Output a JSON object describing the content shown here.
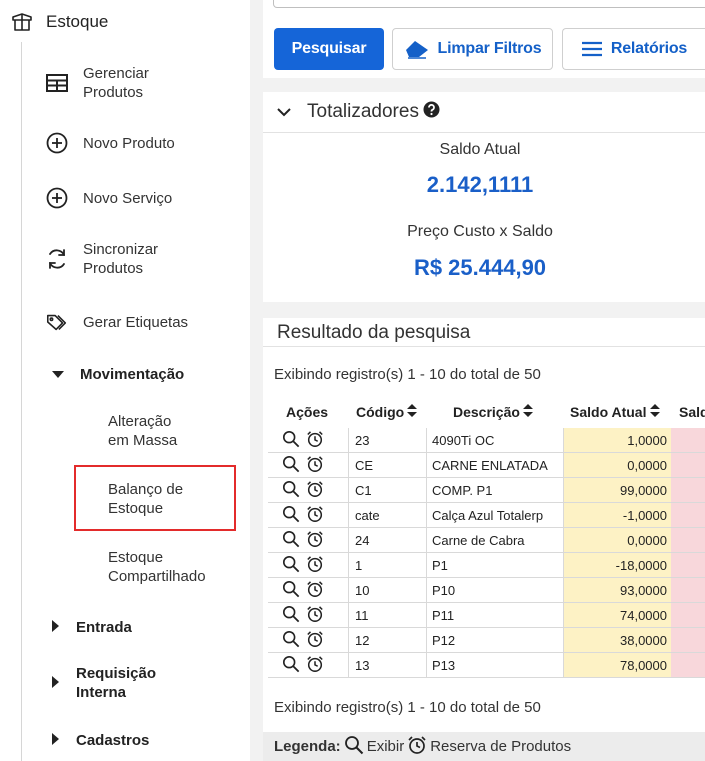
{
  "sidebar": {
    "module": "Estoque",
    "items": [
      {
        "label": "Gerenciar\nProdutos",
        "icon": "product-list-icon"
      },
      {
        "label": "Novo Produto",
        "icon": "plus-circle-icon"
      },
      {
        "label": "Novo Serviço",
        "icon": "plus-circle-icon"
      },
      {
        "label": "Sincronizar\nProdutos",
        "icon": "sync-icon"
      },
      {
        "label": "Gerar Etiquetas",
        "icon": "tag-icon"
      }
    ],
    "movimentacao": {
      "label": "Movimentação",
      "subitems": [
        "Alteração\nem Massa",
        "Balanço de\nEstoque",
        "Estoque\nCompartilhado"
      ]
    },
    "groups": [
      "Entrada",
      "Requisição\nInterna",
      "Cadastros"
    ]
  },
  "toolbar": {
    "search_label": "Pesquisar",
    "clear_label": "Limpar Filtros",
    "reports_label": "Relatórios"
  },
  "totals": {
    "title": "Totalizadores",
    "saldo_label": "Saldo Atual",
    "saldo_value": "2.142,1111",
    "custo_label": "Preço Custo x Saldo",
    "custo_value": "R$ 25.444,90"
  },
  "results": {
    "title": "Resultado da pesquisa",
    "info_top": "Exibindo registro(s) 1 - 10 do total de 50",
    "info_bottom": "Exibindo registro(s) 1 - 10 do total de 50",
    "columns": {
      "acoes": "Ações",
      "codigo": "Código",
      "descricao": "Descrição",
      "saldo": "Saldo Atual",
      "next": "Sald"
    },
    "rows": [
      {
        "codigo": "23",
        "descricao": "4090Ti OC",
        "saldo": "1,0000"
      },
      {
        "codigo": "CE",
        "descricao": "CARNE ENLATADA",
        "saldo": "0,0000"
      },
      {
        "codigo": "C1",
        "descricao": "COMP. P1",
        "saldo": "99,0000"
      },
      {
        "codigo": "cate",
        "descricao": "Calça Azul Totalerp",
        "saldo": "-1,0000"
      },
      {
        "codigo": "24",
        "descricao": "Carne de Cabra",
        "saldo": "0,0000"
      },
      {
        "codigo": "1",
        "descricao": "P1",
        "saldo": "-18,0000"
      },
      {
        "codigo": "10",
        "descricao": "P10",
        "saldo": "93,0000"
      },
      {
        "codigo": "11",
        "descricao": "P11",
        "saldo": "74,0000"
      },
      {
        "codigo": "12",
        "descricao": "P12",
        "saldo": "38,0000"
      },
      {
        "codigo": "13",
        "descricao": "P13",
        "saldo": "78,0000"
      }
    ]
  },
  "legend": {
    "label": "Legenda:",
    "view_label": "Exibir",
    "reserve_label": "Reserva de Produtos"
  },
  "colors": {
    "primary": "#1565d8",
    "value_blue": "#1a5fc8",
    "highlight_red": "#e32b2b",
    "saldo_bg": "#fdf2c5",
    "next_bg": "#f8d7db"
  }
}
